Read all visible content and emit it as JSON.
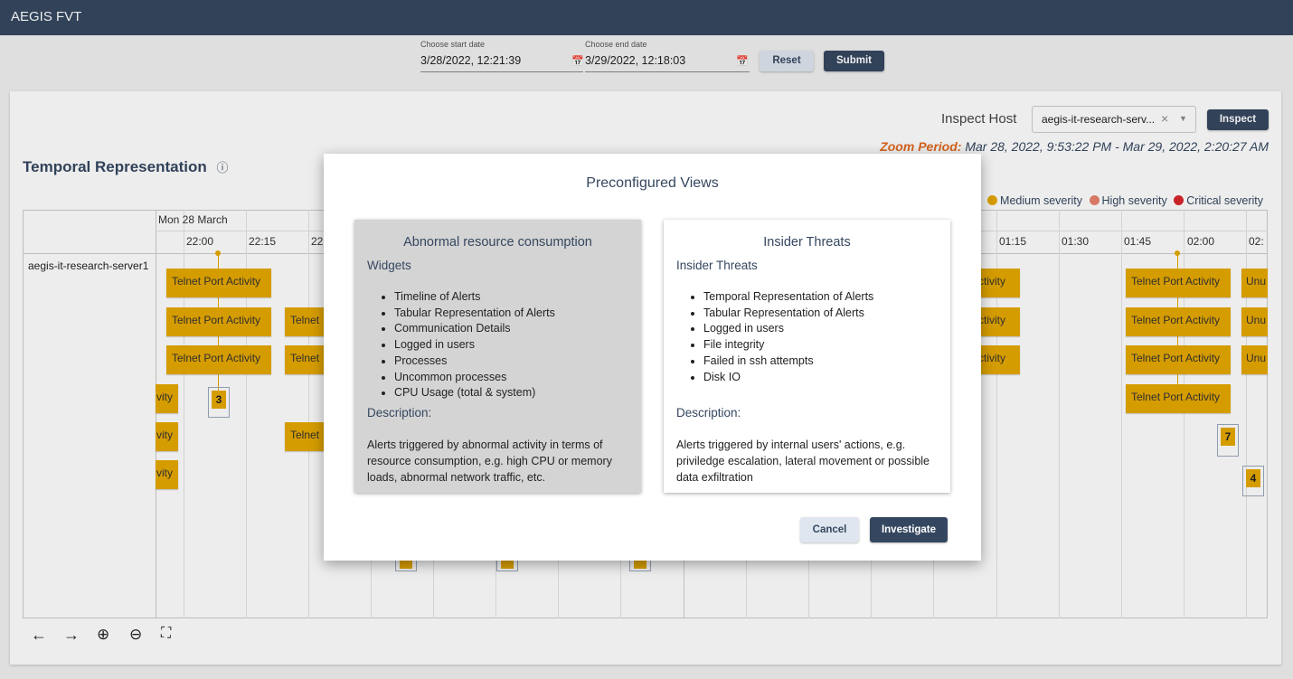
{
  "app": {
    "title": "AEGIS FVT"
  },
  "date_filter": {
    "start_label": "Choose start date",
    "start_value": "3/28/2022, 12:21:39",
    "end_label": "Choose end date",
    "end_value": "3/29/2022, 12:18:03",
    "reset_label": "Reset",
    "submit_label": "Submit"
  },
  "inspect": {
    "label": "Inspect Host",
    "selected_host": "aegis-it-research-serv...",
    "clear_glyph": "×",
    "dropdown_glyph": "▼",
    "button_label": "Inspect"
  },
  "zoom": {
    "label": "Zoom Period:",
    "value": "Mar 28, 2022, 9:53:22 PM - Mar 29, 2022, 2:20:27 AM"
  },
  "section": {
    "title": "Temporal Representation",
    "info_icon": "ⓘ"
  },
  "legend": [
    {
      "label": "Medium severity",
      "color": "#e6a800"
    },
    {
      "label": "High severity",
      "color": "#e8836e"
    },
    {
      "label": "Critical severity",
      "color": "#d9262c"
    }
  ],
  "timeline": {
    "date_header": "Mon 28 March",
    "ticks_left": [
      "22:00",
      "22:15",
      "22"
    ],
    "ticks_right": [
      "01:15",
      "01:30",
      "01:45",
      "02:00",
      "02:"
    ],
    "host": "aegis-it-research-server1",
    "events": {
      "telnet": "Telnet Port Activity",
      "telnet_short": "Telnet",
      "activity_right": "ctivity",
      "activity_left": "vity",
      "unu": "Unu"
    },
    "counts": [
      "3",
      "7",
      "4"
    ]
  },
  "modal": {
    "title": "Preconfigured Views",
    "views": [
      {
        "title": "Abnormal resource consumption",
        "widgets_heading": "Widgets",
        "widgets": [
          "Timeline of Alerts",
          "Tabular Representation of Alerts",
          "Communication Details",
          "Logged in users",
          "Processes",
          "Uncommon processes",
          "CPU Usage (total & system)"
        ],
        "description_heading": "Description:",
        "description": "Alerts triggered by abnormal activity in terms of resource consumption, e.g. high CPU or memory loads, abnormal network traffic, etc."
      },
      {
        "title": "Insider Threats",
        "widgets_heading": "Insider Threats",
        "widgets": [
          "Temporal Representation of Alerts",
          "Tabular Representation of Alerts",
          "Logged in users",
          "File integrity",
          "Failed in ssh attempts",
          "Disk IO"
        ],
        "description_heading": "Description:",
        "description": "Alerts triggered by internal users' actions, e.g. priviledge escalation, lateral movement or possible data exfiltration"
      }
    ],
    "cancel_label": "Cancel",
    "investigate_label": "Investigate"
  },
  "toolbar": {
    "back_icon": "←",
    "forward_icon": "→",
    "zoom_in_icon": "⊕",
    "zoom_out_icon": "⊖",
    "fit_icon": "⛶"
  }
}
